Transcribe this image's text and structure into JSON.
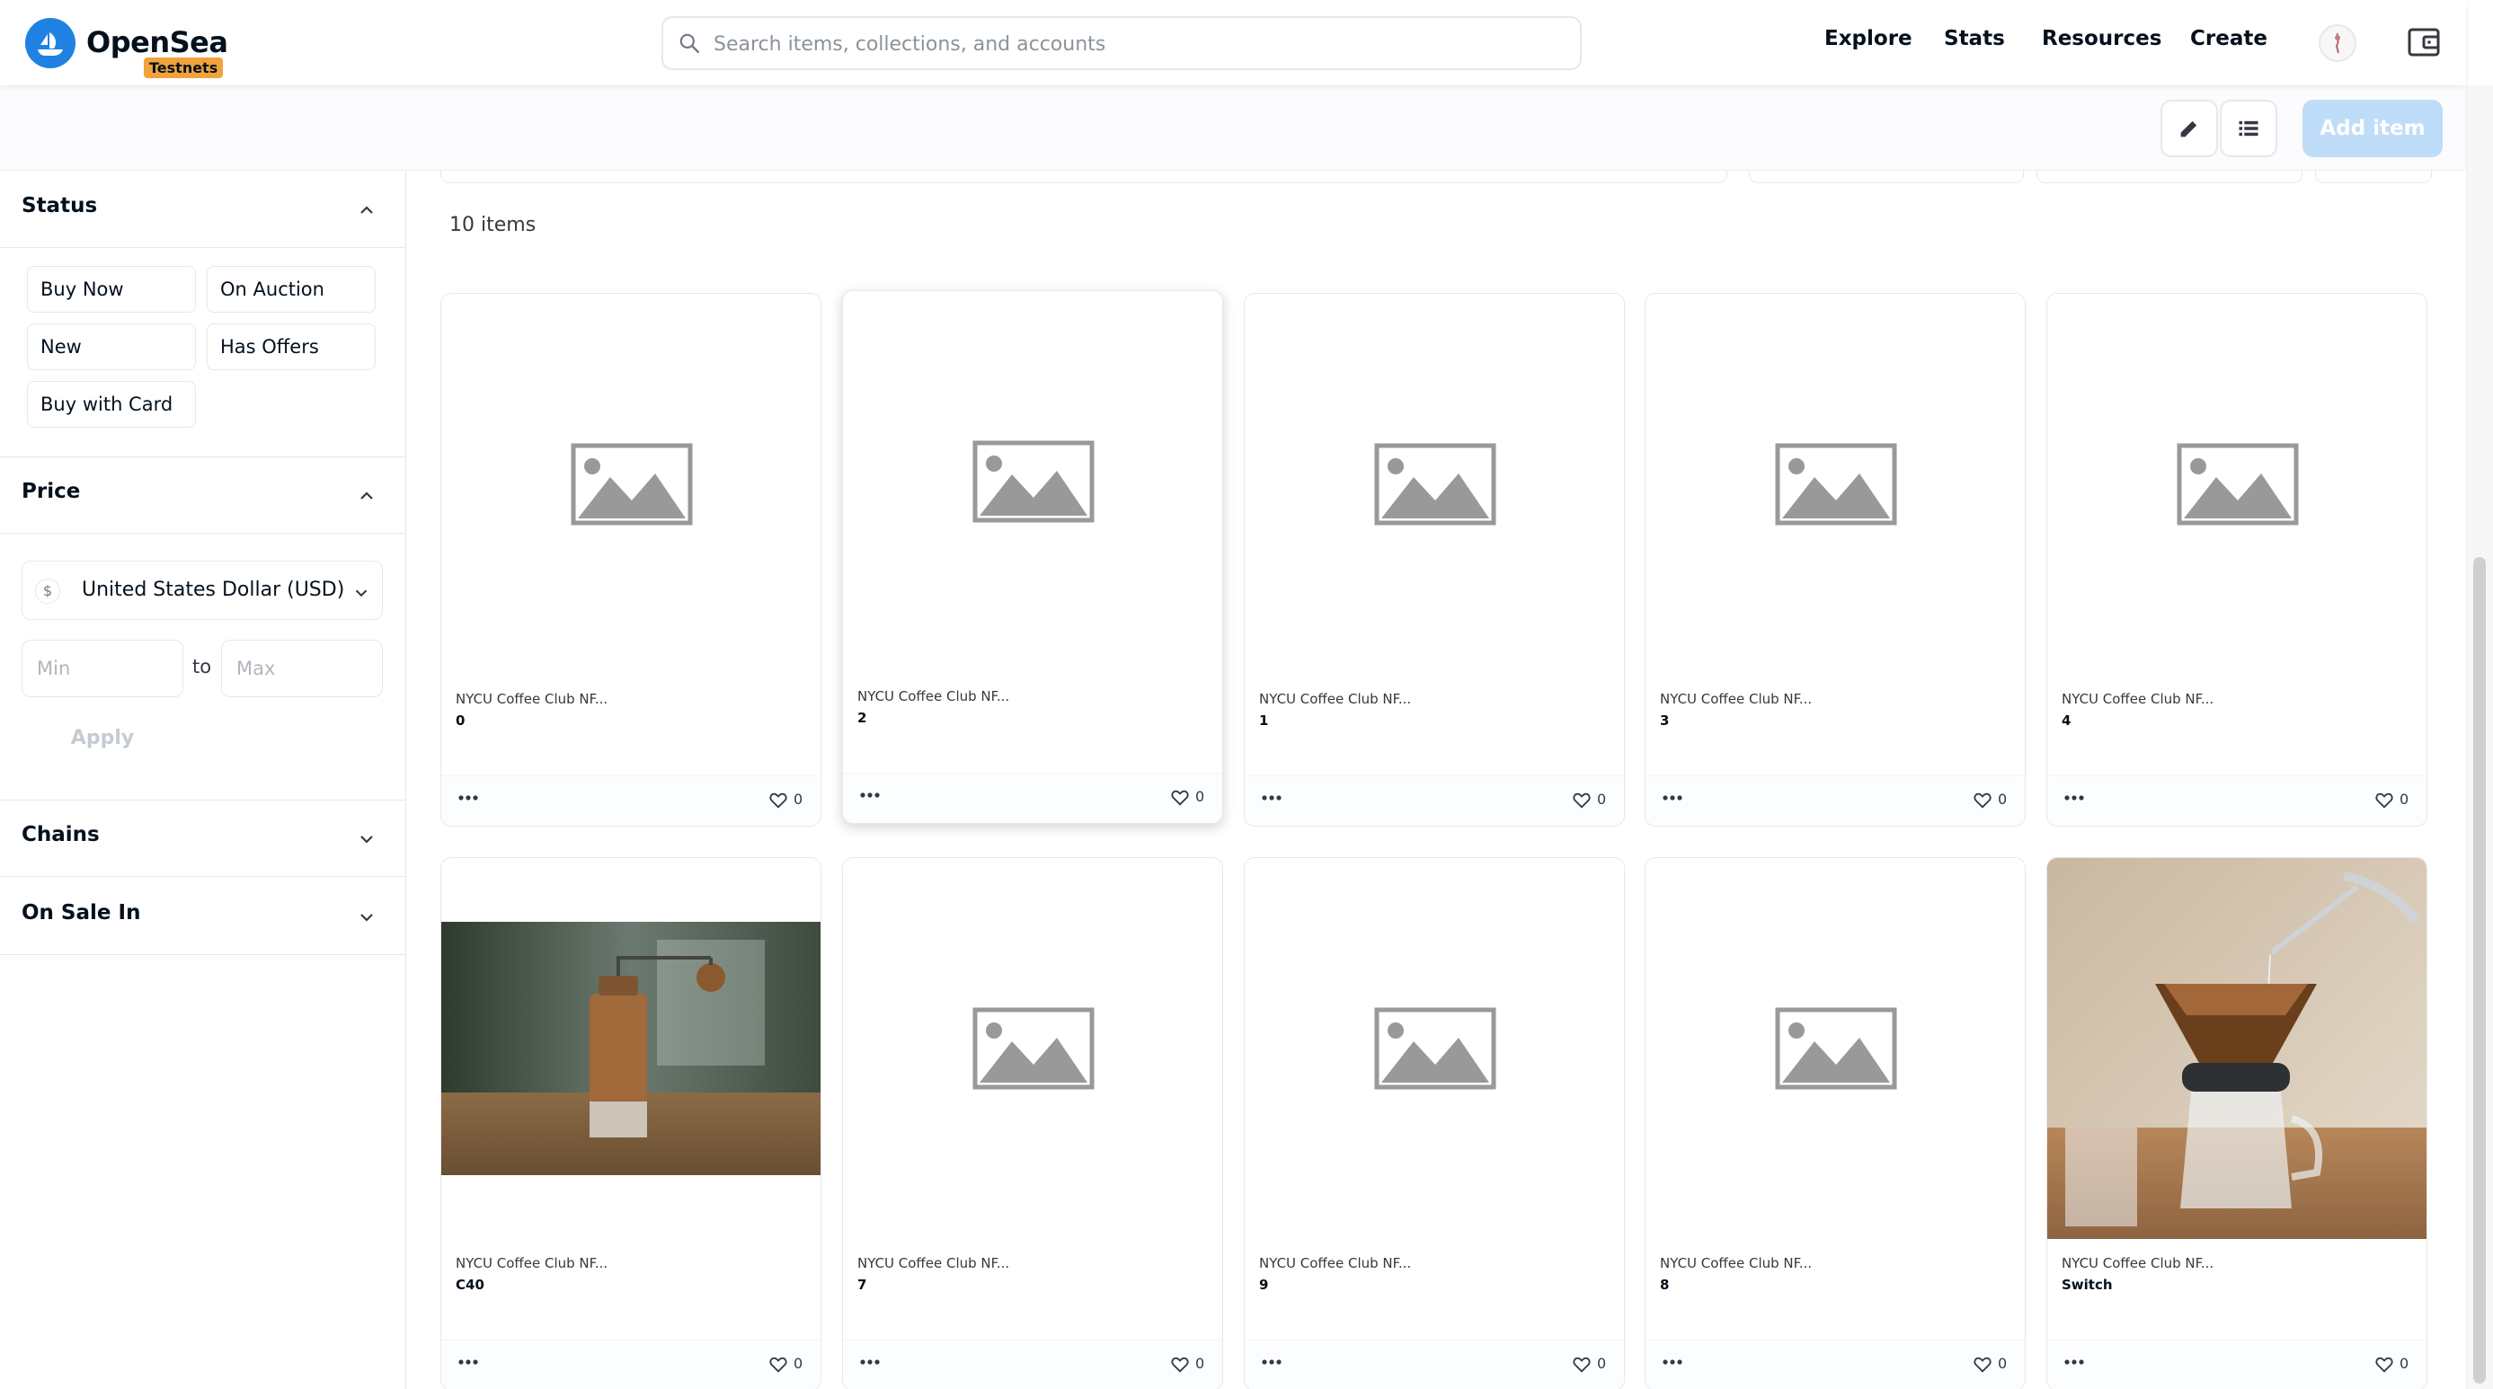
{
  "header": {
    "brand": "OpenSea",
    "badge": "Testnets",
    "search_placeholder": "Search items, collections, and accounts",
    "nav": [
      "Explore",
      "Stats",
      "Resources",
      "Create"
    ]
  },
  "toolbar": {
    "add_item": "Add item"
  },
  "sidebar": {
    "status": {
      "title": "Status",
      "options": [
        "Buy Now",
        "On Auction",
        "New",
        "Has Offers",
        "Buy with Card"
      ]
    },
    "price": {
      "title": "Price",
      "currency_symbol": "$",
      "currency": "United States Dollar (USD)",
      "min_placeholder": "Min",
      "to": "to",
      "max_placeholder": "Max",
      "apply": "Apply"
    },
    "chains": {
      "title": "Chains"
    },
    "on_sale_in": {
      "title": "On Sale In"
    }
  },
  "main": {
    "count": "10 items",
    "items": [
      {
        "collection": "NYCU Coffee Club NF...",
        "name": "0",
        "likes": "0"
      },
      {
        "collection": "NYCU Coffee Club NF...",
        "name": "2",
        "likes": "0"
      },
      {
        "collection": "NYCU Coffee Club NF...",
        "name": "1",
        "likes": "0"
      },
      {
        "collection": "NYCU Coffee Club NF...",
        "name": "3",
        "likes": "0"
      },
      {
        "collection": "NYCU Coffee Club NF...",
        "name": "4",
        "likes": "0"
      },
      {
        "collection": "NYCU Coffee Club NF...",
        "name": "C40",
        "likes": "0"
      },
      {
        "collection": "NYCU Coffee Club NF...",
        "name": "7",
        "likes": "0"
      },
      {
        "collection": "NYCU Coffee Club NF...",
        "name": "9",
        "likes": "0"
      },
      {
        "collection": "NYCU Coffee Club NF...",
        "name": "8",
        "likes": "0"
      },
      {
        "collection": "NYCU Coffee Club NF...",
        "name": "Switch",
        "likes": "0"
      }
    ]
  },
  "colors": {
    "brand": "#2081e2",
    "badge": "#f0a33a",
    "add_item_disabled": "#bfdcf8"
  }
}
